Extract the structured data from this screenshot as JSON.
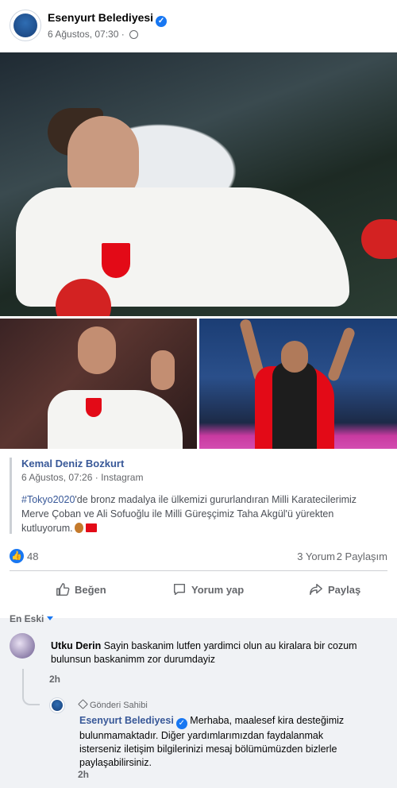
{
  "post": {
    "page_name": "Esenyurt Belediyesi",
    "date": "6 Ağustos, 07:30",
    "meta_separator": "·"
  },
  "shared": {
    "author": "Kemal Deniz Bozkurt",
    "date": "6 Ağustos, 07:26",
    "source": "Instagram",
    "hashtag": "#Tokyo2020",
    "text": "'de bronz madalya ile ülkemizi gururlandıran Milli Karatecilerimiz Merve Çoban ve Ali Sofuoğlu ile Milli Güreşçimiz Taha Akgül'ü yürekten kutluyorum."
  },
  "reactions": {
    "count": "48",
    "comments": "3 Yorum",
    "shares": "2 Paylaşım"
  },
  "actions": {
    "like": "Beğen",
    "comment": "Yorum yap",
    "share": "Paylaş"
  },
  "comments": {
    "sort_label": "En Eski",
    "items": [
      {
        "name": "Utku Derin",
        "text": "Sayin baskanim lutfen yardimci olun au kiralara bir cozum bulunsun baskanimm zor durumdayiz",
        "time": "2h"
      },
      {
        "author_tag": "Gönderi Sahibi",
        "name": "Esenyurt Belediyesi",
        "text": "Merhaba, maalesef kira desteğimiz bulunmamaktadır. Diğer yardımlarımızdan faydalanmak isterseniz iletişim bilgilerinizi mesaj bölümümüzden bizlerle paylaşabilirsiniz.",
        "time": "2h"
      }
    ]
  },
  "colors": {
    "facebook_blue": "#1877f2",
    "link_blue": "#385898",
    "muted_text": "#65676b",
    "bubble_bg": "#f0f2f5"
  }
}
